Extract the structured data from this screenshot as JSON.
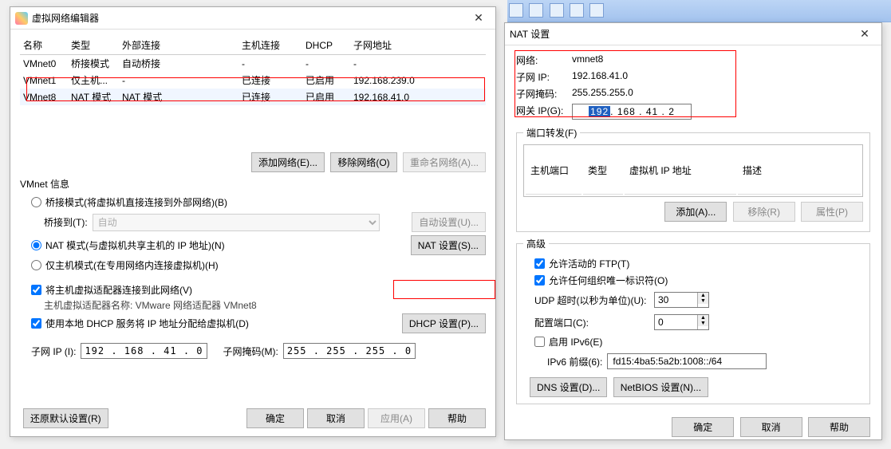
{
  "left": {
    "title": "虚拟网络编辑器",
    "columns": [
      "名称",
      "类型",
      "外部连接",
      "主机连接",
      "DHCP",
      "子网地址"
    ],
    "rows": [
      {
        "name": "VMnet0",
        "type": "桥接模式",
        "ext": "自动桥接",
        "host": "-",
        "dhcp": "-",
        "subnet": "-"
      },
      {
        "name": "VMnet1",
        "type": "仅主机...",
        "ext": "-",
        "host": "已连接",
        "dhcp": "已启用",
        "subnet": "192.168.239.0"
      },
      {
        "name": "VMnet8",
        "type": "NAT 模式",
        "ext": "NAT 模式",
        "host": "已连接",
        "dhcp": "已启用",
        "subnet": "192.168.41.0"
      }
    ],
    "buttons": {
      "add": "添加网络(E)...",
      "remove": "移除网络(O)",
      "rename": "重命名网络(A)..."
    },
    "info_label": "VMnet 信息",
    "radio_bridge": "桥接模式(将虚拟机直接连接到外部网络)(B)",
    "bridge_to": "桥接到(T):",
    "bridge_value": "自动",
    "auto_set": "自动设置(U)...",
    "radio_nat": "NAT 模式(与虚拟机共享主机的 IP 地址)(N)",
    "nat_set": "NAT 设置(S)...",
    "radio_host": "仅主机模式(在专用网络内连接虚拟机)(H)",
    "chk_adapter": "将主机虚拟适配器连接到此网络(V)",
    "adapter_name_lbl": "主机虚拟适配器名称: VMware 网络适配器 VMnet8",
    "chk_dhcp": "使用本地 DHCP 服务将 IP 地址分配给虚拟机(D)",
    "dhcp_set": "DHCP 设置(P)...",
    "subnet_ip_lbl": "子网 IP (I):",
    "subnet_ip": "192 . 168 . 41 . 0",
    "subnet_mask_lbl": "子网掩码(M):",
    "subnet_mask": "255 . 255 . 255 . 0",
    "restore": "还原默认设置(R)",
    "ok": "确定",
    "cancel": "取消",
    "apply": "应用(A)",
    "help": "帮助"
  },
  "right": {
    "title": "NAT 设置",
    "net_lbl": "网络:",
    "net": "vmnet8",
    "subip_lbl": "子网 IP:",
    "subip": "192.168.41.0",
    "mask_lbl": "子网掩码:",
    "mask": "255.255.255.0",
    "gw_lbl": "网关 IP(G):",
    "gw_sel": "192",
    "gw_rest": ". 168 . 41 . 2",
    "portfwd": "端口转发(F)",
    "pcols": [
      "主机端口",
      "类型",
      "虚拟机 IP 地址",
      "描述"
    ],
    "add": "添加(A)...",
    "remove": "移除(R)",
    "props": "属性(P)",
    "adv": "高级",
    "chk_ftp": "允许活动的 FTP(T)",
    "chk_oid": "允许任何组织唯一标识符(O)",
    "udp_lbl": "UDP 超时(以秒为单位)(U):",
    "udp": "30",
    "cfgport_lbl": "配置端口(C):",
    "cfgport": "0",
    "chk_ipv6": "启用 IPv6(E)",
    "ipv6p_lbl": "IPv6 前缀(6):",
    "ipv6p": "fd15:4ba5:5a2b:1008::/64",
    "dns": "DNS 设置(D)...",
    "netbios": "NetBIOS 设置(N)...",
    "ok": "确定",
    "cancel": "取消",
    "help": "帮助"
  }
}
